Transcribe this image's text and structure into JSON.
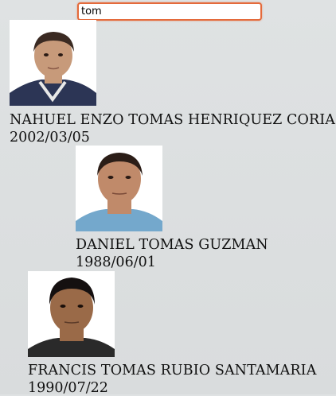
{
  "search": {
    "value": "tom",
    "accent_color": "#e46a3b"
  },
  "results": [
    {
      "name": "NAHUEL ENZO TOMAS HENRIQUEZ CORIA",
      "dob": "2002/03/05",
      "photo": {
        "bg": "#ffffff",
        "skin": "#c79a7a",
        "hair": "#3a2a22",
        "shirt": "#2c3555"
      }
    },
    {
      "name": "DANIEL TOMAS GUZMAN",
      "dob": "1988/06/01",
      "photo": {
        "bg": "#ffffff",
        "skin": "#c08a6a",
        "hair": "#2b1d17",
        "shirt": "#74a8cc"
      }
    },
    {
      "name": "FRANCIS TOMAS RUBIO SANTAMARIA",
      "dob": "1990/07/22",
      "photo": {
        "bg": "#ffffff",
        "skin": "#9a6a48",
        "hair": "#151010",
        "shirt": "#2a2a2a"
      }
    }
  ]
}
